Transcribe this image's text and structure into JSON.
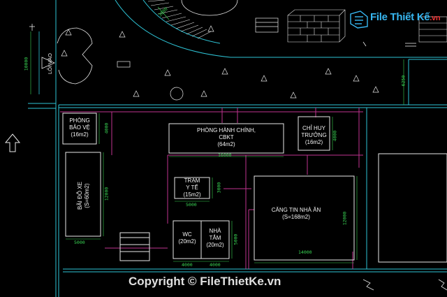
{
  "brand": {
    "logo_text": "File Thiết Kế",
    "logo_suffix": ".vn",
    "copyright": "Copyright © FileThietKe.vn"
  },
  "labels": {
    "entrance": "LỐI VÀO",
    "guard": "PHÒNG\nBẢO VỆ\n(16m2)",
    "admin": "PHÒNG HÀNH CHÍNH,\nCBKT\n(64m2)",
    "commander": "CHỈ HUY\nTRƯỞNG\n(16m2)",
    "parking": "BÃI ĐỖ XE\n(S=60m2)",
    "medical": "TRẠM\nY TẾ\n(15m2)",
    "canteen": "CĂNG TIN NHÀ ĂN\n(S=168m2)",
    "wc": "WC\n(20m2)",
    "bath": "NHÀ\nTẮM\n(20m2)"
  },
  "dims": {
    "d10000": "10000",
    "d3000a": "3000",
    "d6250": "6250",
    "d4000a": "4000",
    "d16000": "16000",
    "d4000b": "4000",
    "d12000a": "12000",
    "d3000b": "3000",
    "d5000a": "5000",
    "d5000b": "5000",
    "d12000b": "12000",
    "d5000c": "5000",
    "d14000": "14000",
    "d4000c": "4000",
    "d4000d": "4000"
  },
  "colors": {
    "cyan": "#2ec4d6",
    "magenta": "#c0338f",
    "white": "#e8e8e8",
    "green": "#39d353",
    "background": "#000000"
  }
}
